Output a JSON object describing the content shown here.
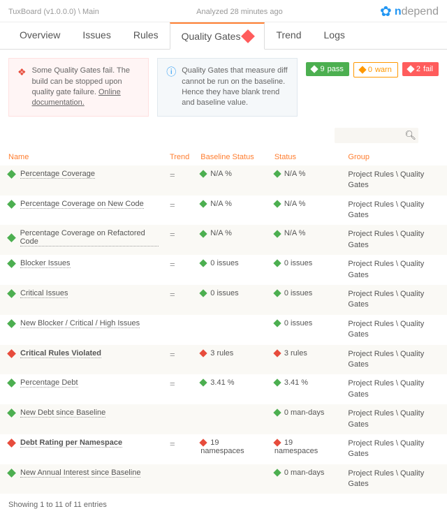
{
  "header": {
    "appTitle": "TuxBoard (v1.0.0.0) \\ Main",
    "analyzed": "Analyzed 28 minutes ago",
    "brand_n": "n",
    "brand_rest": "depend"
  },
  "tabs": {
    "items": [
      {
        "label": "Overview"
      },
      {
        "label": "Issues"
      },
      {
        "label": "Rules"
      },
      {
        "label": "Quality Gates"
      },
      {
        "label": "Trend"
      },
      {
        "label": "Logs"
      }
    ],
    "activeIndex": 3
  },
  "alerts": {
    "warn": {
      "text": "Some Quality Gates fail. The build can be stopped upon quality gate failure. ",
      "link": "Online documentation."
    },
    "info": {
      "text": "Quality Gates that measure diff cannot be run on the baseline. Hence they have blank trend and baseline value."
    }
  },
  "badges": {
    "pass": {
      "count": "9",
      "label": "pass"
    },
    "warn": {
      "count": "0",
      "label": "warn"
    },
    "fail": {
      "count": "2",
      "label": "fail"
    }
  },
  "columns": {
    "name": "Name",
    "trend": "Trend",
    "baseline": "Baseline Status",
    "status": "Status",
    "group": "Group"
  },
  "groupText": "Project Rules \\ Quality Gates",
  "rows": [
    {
      "name": "Percentage Coverage",
      "icon": "green",
      "trend": "=",
      "baseline": {
        "icon": "green",
        "text": "N/A %"
      },
      "status": {
        "icon": "green",
        "text": "N/A %"
      },
      "bold": false
    },
    {
      "name": "Percentage Coverage on New Code",
      "icon": "green",
      "trend": "=",
      "baseline": {
        "icon": "green",
        "text": "N/A %"
      },
      "status": {
        "icon": "green",
        "text": "N/A %"
      },
      "bold": false
    },
    {
      "name": "Percentage Coverage on Refactored Code",
      "icon": "green",
      "trend": "=",
      "baseline": {
        "icon": "green",
        "text": "N/A %"
      },
      "status": {
        "icon": "green",
        "text": "N/A %"
      },
      "bold": false
    },
    {
      "name": "Blocker Issues",
      "icon": "green",
      "trend": "=",
      "baseline": {
        "icon": "green",
        "text": "0 issues"
      },
      "status": {
        "icon": "green",
        "text": "0 issues"
      },
      "bold": false
    },
    {
      "name": "Critical Issues",
      "icon": "green",
      "trend": "=",
      "baseline": {
        "icon": "green",
        "text": "0 issues"
      },
      "status": {
        "icon": "green",
        "text": "0 issues"
      },
      "bold": false
    },
    {
      "name": "New Blocker / Critical / High Issues",
      "icon": "green",
      "trend": "",
      "baseline": {
        "icon": "",
        "text": ""
      },
      "status": {
        "icon": "green",
        "text": "0 issues"
      },
      "bold": false
    },
    {
      "name": "Critical Rules Violated",
      "icon": "red",
      "trend": "=",
      "baseline": {
        "icon": "red",
        "text": "3 rules"
      },
      "status": {
        "icon": "red",
        "text": "3 rules"
      },
      "bold": true
    },
    {
      "name": "Percentage Debt",
      "icon": "green",
      "trend": "=",
      "baseline": {
        "icon": "green",
        "text": "3.41 %"
      },
      "status": {
        "icon": "green",
        "text": "3.41 %"
      },
      "bold": false
    },
    {
      "name": "New Debt since Baseline",
      "icon": "green",
      "trend": "",
      "baseline": {
        "icon": "",
        "text": ""
      },
      "status": {
        "icon": "green",
        "text": "0 man-days"
      },
      "bold": false
    },
    {
      "name": "Debt Rating per Namespace",
      "icon": "red",
      "trend": "=",
      "baseline": {
        "icon": "red",
        "text": "19 namespaces"
      },
      "status": {
        "icon": "red",
        "text": "19 namespaces"
      },
      "bold": true
    },
    {
      "name": "New Annual Interest since Baseline",
      "icon": "green",
      "trend": "",
      "baseline": {
        "icon": "",
        "text": ""
      },
      "status": {
        "icon": "green",
        "text": "0 man-days"
      },
      "bold": false
    }
  ],
  "footer": "Showing 1 to 11 of 11 entries"
}
